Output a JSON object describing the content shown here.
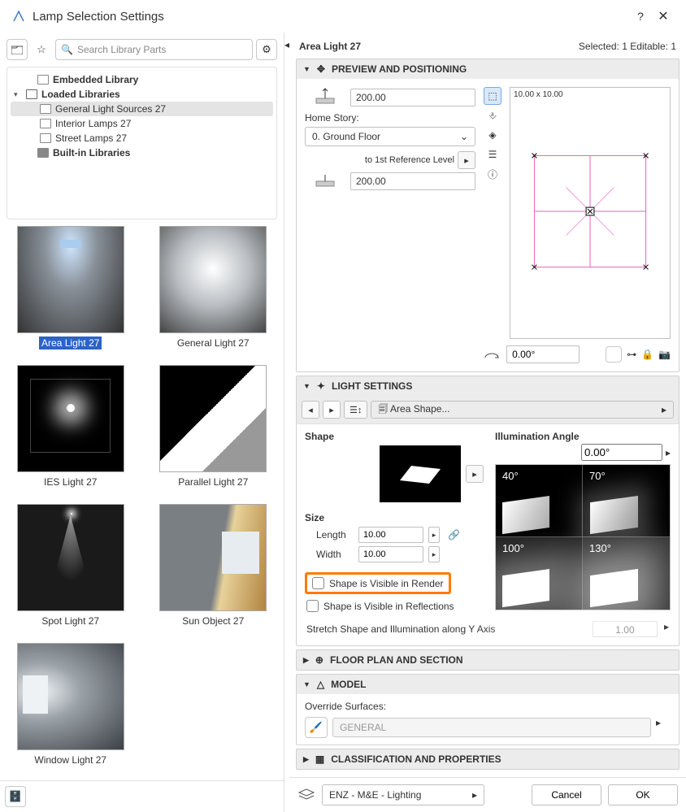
{
  "window": {
    "title": "Lamp Selection Settings"
  },
  "search": {
    "placeholder": "Search Library Parts"
  },
  "tree": {
    "embedded": "Embedded Library",
    "loaded": "Loaded Libraries",
    "general": "General Light Sources 27",
    "interior": "Interior Lamps 27",
    "street": "Street Lamps 27",
    "builtin": "Built-in Libraries"
  },
  "gallery": [
    {
      "label": "Area Light 27",
      "selected": true
    },
    {
      "label": "General Light 27"
    },
    {
      "label": "IES Light 27"
    },
    {
      "label": "Parallel Light 27"
    },
    {
      "label": "Spot Light 27"
    },
    {
      "label": "Sun Object 27"
    },
    {
      "label": "Window Light 27"
    }
  ],
  "header": {
    "name": "Area Light 27",
    "status": "Selected: 1 Editable: 1"
  },
  "panels": {
    "preview": "PREVIEW AND POSITIONING",
    "light": "LIGHT SETTINGS",
    "floorplan": "FLOOR PLAN AND SECTION",
    "model": "MODEL",
    "class": "CLASSIFICATION AND PROPERTIES"
  },
  "pos": {
    "elev": "200.00",
    "homeStoryLabel": "Home Story:",
    "homeStory": "0. Ground Floor",
    "refLabel": "to 1st Reference Level",
    "refElev": "200.00",
    "previewDim": "10.00 x 10.00",
    "rot": "0.00°"
  },
  "light": {
    "areaShape": "Area Shape...",
    "shapeLabel": "Shape",
    "sizeLabel": "Size",
    "lengthLabel": "Length",
    "lengthVal": "10.00",
    "widthLabel": "Width",
    "widthVal": "10.00",
    "chkRender": "Shape is Visible in Render",
    "chkRefl": "Shape is Visible in Reflections",
    "illLabel": "Illumination Angle",
    "illVal": "0.00°",
    "ill40": "40°",
    "ill70": "70°",
    "ill100": "100°",
    "ill130": "130°",
    "stretch": "Stretch Shape and Illumination along Y Axis",
    "stretchVal": "1.00"
  },
  "model": {
    "override": "Override Surfaces:",
    "general": "GENERAL"
  },
  "footer": {
    "layer": "ENZ - M&E - Lighting",
    "cancel": "Cancel",
    "ok": "OK"
  }
}
